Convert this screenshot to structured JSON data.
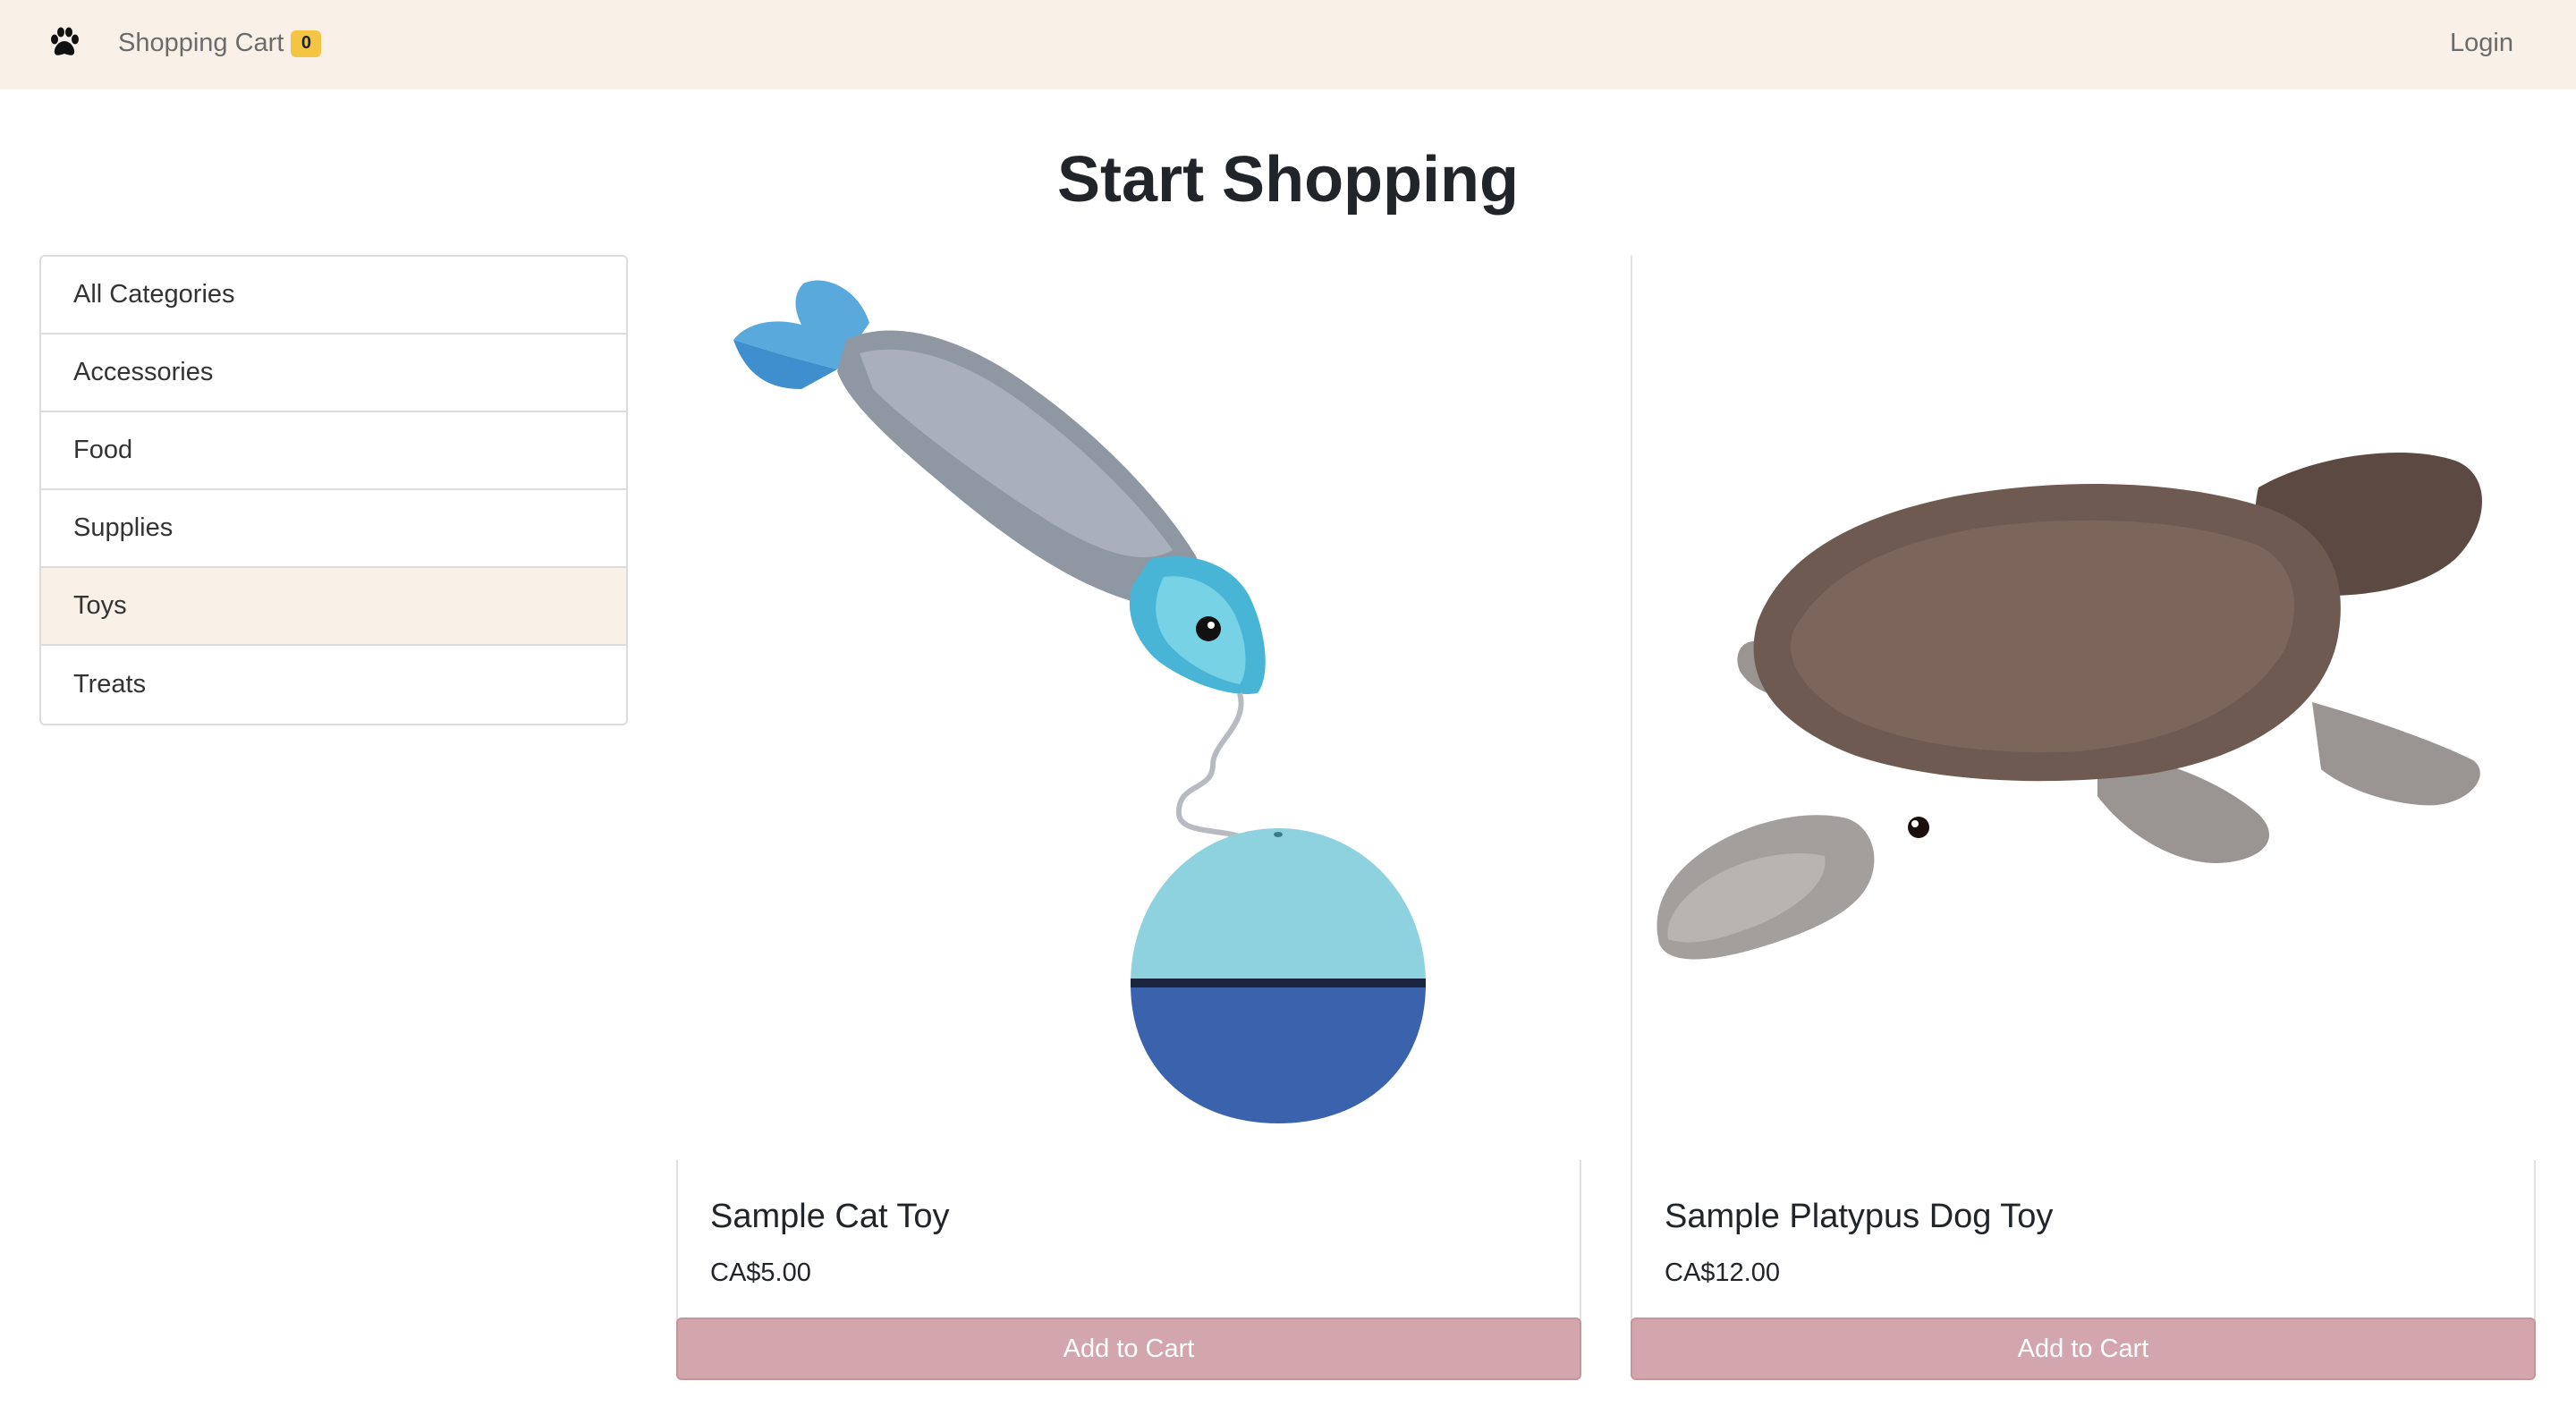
{
  "navbar": {
    "brand_icon": "paw-icon",
    "cart_label": "Shopping Cart",
    "cart_count": "0",
    "login_label": "Login",
    "background": "#f9f1e8"
  },
  "main": {
    "title": "Start Shopping"
  },
  "sidebar": {
    "items": [
      {
        "label": "All Categories",
        "active": false
      },
      {
        "label": "Accessories",
        "active": false
      },
      {
        "label": "Food",
        "active": false
      },
      {
        "label": "Supplies",
        "active": false
      },
      {
        "label": "Toys",
        "active": true
      },
      {
        "label": "Treats",
        "active": false
      }
    ]
  },
  "products": [
    {
      "name": "Sample Cat Toy",
      "price": "CA$5.00",
      "button_label": "Add to Cart",
      "image": "cat-toy-fish-ball-image"
    },
    {
      "name": "Sample Platypus Dog Toy",
      "price": "CA$12.00",
      "button_label": "Add to Cart",
      "image": "platypus-plush-image"
    }
  ],
  "colors": {
    "accent": "#d3a6ad",
    "badge": "#f4c542",
    "active_item": "#f9f1e8"
  }
}
